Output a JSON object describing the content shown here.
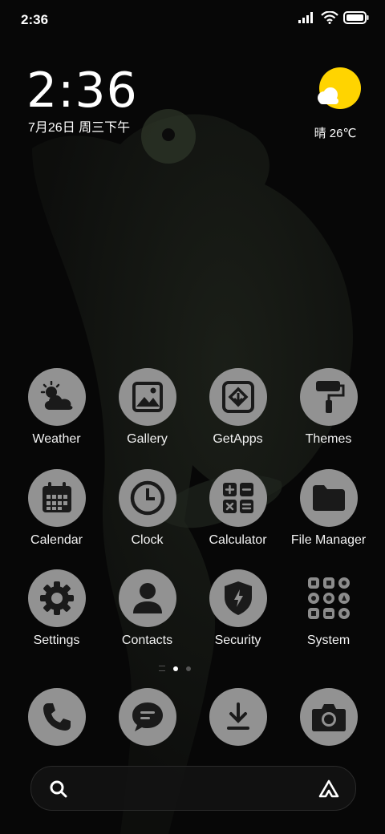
{
  "status_bar": {
    "time": "2:36",
    "icons": [
      "signal-icon",
      "wifi-icon",
      "battery-icon"
    ]
  },
  "clock_widget": {
    "time": "2:36",
    "date": "7月26日 周三下午"
  },
  "weather_widget": {
    "icon": "sun-cloud-icon",
    "text": "晴 26℃",
    "sun_color": "#FFD400"
  },
  "apps": [
    {
      "label": "Weather",
      "icon": "weather-icon"
    },
    {
      "label": "Gallery",
      "icon": "gallery-icon"
    },
    {
      "label": "GetApps",
      "icon": "getapps-icon"
    },
    {
      "label": "Themes",
      "icon": "themes-icon"
    },
    {
      "label": "Calendar",
      "icon": "calendar-icon"
    },
    {
      "label": "Clock",
      "icon": "clock-icon"
    },
    {
      "label": "Calculator",
      "icon": "calculator-icon"
    },
    {
      "label": "File Manager",
      "icon": "folder-icon"
    },
    {
      "label": "Settings",
      "icon": "gear-icon"
    },
    {
      "label": "Contacts",
      "icon": "contacts-icon"
    },
    {
      "label": "Security",
      "icon": "shield-icon"
    },
    {
      "label": "System",
      "icon": "system-folder-icon"
    }
  ],
  "dock": [
    {
      "icon": "phone-icon"
    },
    {
      "icon": "messages-icon"
    },
    {
      "icon": "download-icon"
    },
    {
      "icon": "camera-icon"
    }
  ],
  "page_indicator": {
    "pages": 3,
    "active": 1
  },
  "search_bar": {
    "left_icon": "search-icon",
    "right_icon": "assistant-icon"
  },
  "colors": {
    "icon_bg": "#929292",
    "icon_glyph": "#1a1a1a",
    "background": "#070707"
  }
}
